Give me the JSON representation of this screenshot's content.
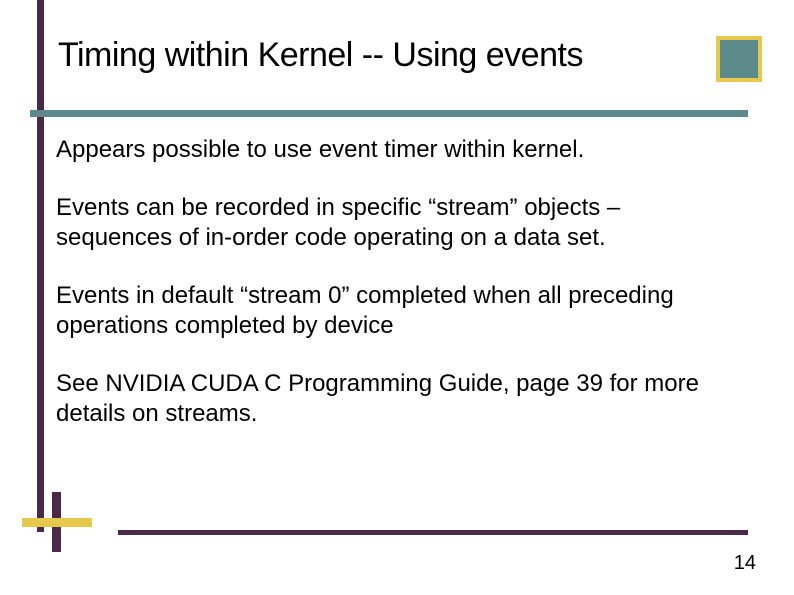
{
  "slide": {
    "title": "Timing within Kernel -- Using events",
    "paragraphs": [
      "Appears possible to use event timer within kernel.",
      "Events can be recorded in specific “stream” objects – sequences of in-order code operating on a data set.",
      "Events in default “stream 0” completed when all preceding operations completed by device",
      "See NVIDIA CUDA  C Programming Guide, page 39 for more details on streams."
    ],
    "page_number": "14"
  }
}
